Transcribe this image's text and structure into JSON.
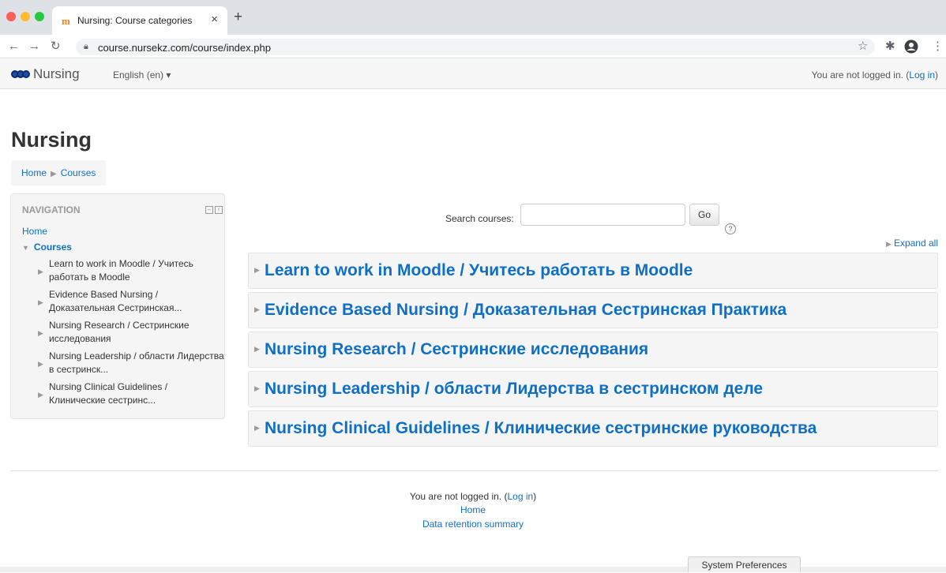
{
  "browser": {
    "colors": {
      "close": "#fe5f57",
      "minimize": "#febc2e",
      "zoom": "#28c840"
    },
    "tab": {
      "icon": "moodle-m-icon",
      "title": "Nursing: Course categories",
      "close": "×"
    },
    "new_tab": "+",
    "url": "course.nursekz.com/course/index.php"
  },
  "navbar": {
    "brand": "Nursing",
    "language": "English (en) ▾",
    "login_prefix": "You are not logged in. (",
    "login_link": "Log in",
    "login_suffix": ")"
  },
  "page": {
    "title": "Nursing",
    "breadcrumb": {
      "home": "Home",
      "courses": "Courses"
    }
  },
  "navigation": {
    "heading": "NAVIGATION",
    "home": "Home",
    "courses": "Courses",
    "items": [
      "Learn to work in Moodle / Учитесь работать в Moodle",
      "Evidence Based Nursing / Доказательная Сестринская...",
      "Nursing Research / Сестринские исследования",
      "Nursing Leadership / области Лидерства в сестринск...",
      "Nursing Clinical Guidelines / Клинические сестринс..."
    ]
  },
  "search": {
    "label": "Search courses:",
    "value": "",
    "button": "Go",
    "help": "?"
  },
  "expand_all": "Expand all",
  "categories": [
    "Learn to work in Moodle / Учитесь работать в Moodle",
    "Evidence Based Nursing / Доказательная Сестринская Практика",
    "Nursing Research / Сестринские исследования",
    "Nursing Leadership / области Лидерства в сестринском деле",
    "Nursing Clinical Guidelines / Клинические сестринские руководства"
  ],
  "footer": {
    "login_prefix": "You are not logged in. (",
    "login_link": "Log in",
    "login_suffix": ")",
    "home": "Home",
    "data_retention": "Data retention summary"
  },
  "system_prefs": "System Preferences"
}
